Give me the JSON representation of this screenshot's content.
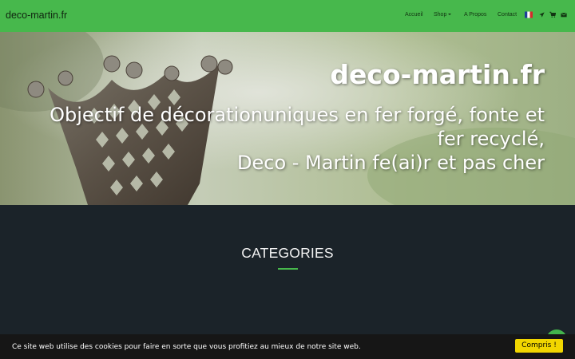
{
  "navbar": {
    "brand": "deco-martin.fr",
    "items": [
      {
        "label": "Accueil"
      },
      {
        "label": "Shop"
      },
      {
        "label": "A Propos"
      },
      {
        "label": "Contact"
      }
    ],
    "icons": [
      "french-flag-icon",
      "send-icon",
      "cart-icon",
      "envelope-icon"
    ]
  },
  "hero": {
    "title": "deco-martin.fr",
    "subtitle_lines": [
      "Objectif de décorationuniques en fer forgé, fonte et",
      "fer recyclé,",
      "Deco - Martin fe(ai)r et pas cher"
    ]
  },
  "categories": {
    "title": "CATEGORIES"
  },
  "cookie": {
    "text": "Ce site web utilise des cookies pour faire en sorte que vous profitiez au mieux de notre site web.",
    "button": "Compris !"
  },
  "colors": {
    "navbar": "#47b84c",
    "accent": "#47b84c",
    "dark_section": "#1b2329",
    "cookie_bar": "#161616",
    "cookie_button": "#f1d600"
  }
}
